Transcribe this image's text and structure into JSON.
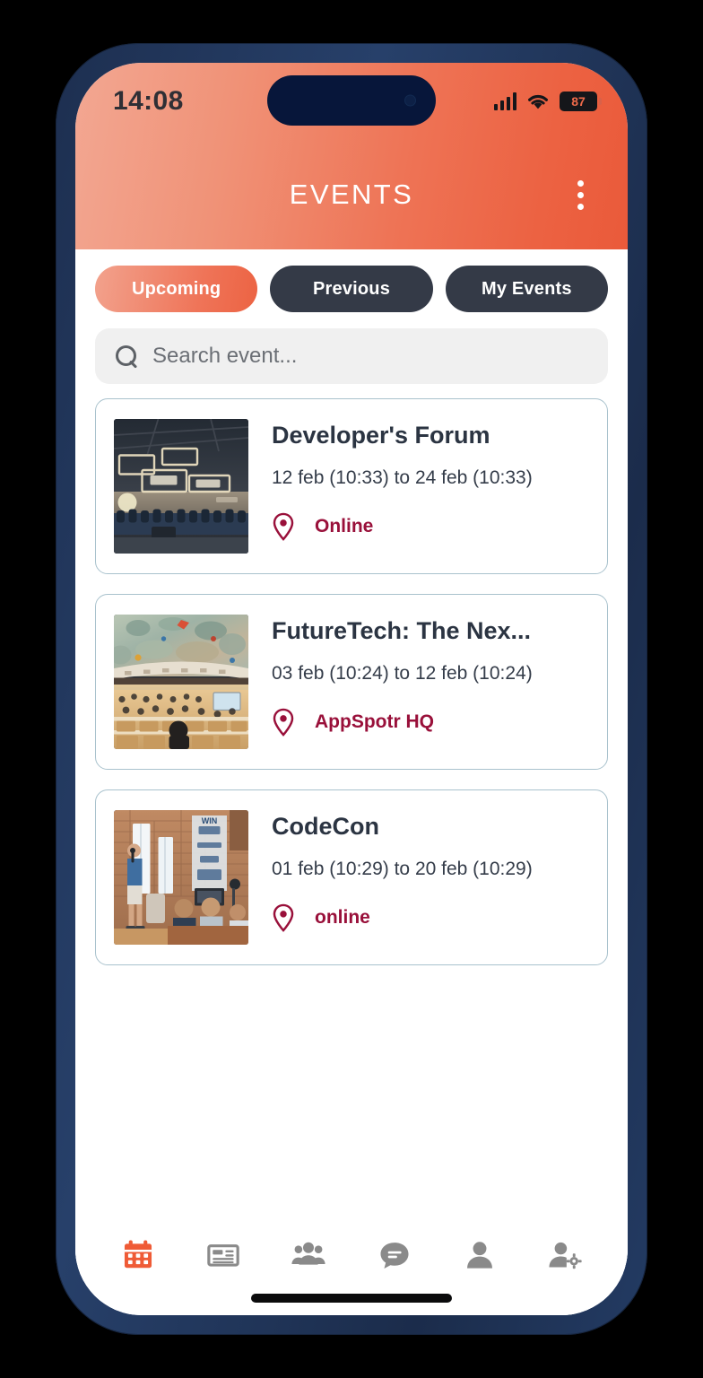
{
  "status_bar": {
    "time": "14:08",
    "battery_level": "87",
    "signal_icon": "cellular-bars-icon",
    "wifi_icon": "wifi-icon",
    "battery_icon": "battery-icon"
  },
  "header": {
    "title": "EVENTS",
    "menu_icon": "kebab-menu-icon",
    "gradient_from": "#f3a792",
    "gradient_to": "#ea5a3a"
  },
  "tabs": [
    {
      "label": "Upcoming",
      "active": true
    },
    {
      "label": "Previous",
      "active": false
    },
    {
      "label": "My Events",
      "active": false
    }
  ],
  "search": {
    "placeholder": "Search event...",
    "value": "",
    "icon": "search-icon"
  },
  "events": [
    {
      "title": "Developer's Forum",
      "dates": "12 feb (10:33) to 24 feb (10:33)",
      "location": "Online",
      "location_icon": "map-pin-icon",
      "thumbnail": "conference-ballroom-coffered-ceiling"
    },
    {
      "title": "FutureTech: The Nex...",
      "dates": "03 feb (10:24) to 12 feb (10:24)",
      "location": "AppSpotr HQ",
      "location_icon": "map-pin-icon",
      "thumbnail": "assembly-hall-domed-ceiling"
    },
    {
      "title": "CodeCon",
      "dates": "01 feb (10:29) to 20 feb (10:29)",
      "location": "online",
      "location_icon": "map-pin-icon",
      "thumbnail": "loft-brick-wall-speaker-audience"
    }
  ],
  "bottom_nav": [
    {
      "icon": "calendar-icon",
      "active": true
    },
    {
      "icon": "newspaper-icon",
      "active": false
    },
    {
      "icon": "people-group-icon",
      "active": false
    },
    {
      "icon": "chat-bubble-icon",
      "active": false
    },
    {
      "icon": "person-icon",
      "active": false
    },
    {
      "icon": "person-settings-icon",
      "active": false
    }
  ],
  "colors": {
    "accent_orange": "#ef5f3f",
    "tab_dark": "#343a47",
    "location_crimson": "#99103a",
    "card_border": "#a9c2cd",
    "search_bg": "#f0f0f0",
    "nav_inactive": "#8a8a8a",
    "frame_navy": "#1d2f50"
  }
}
